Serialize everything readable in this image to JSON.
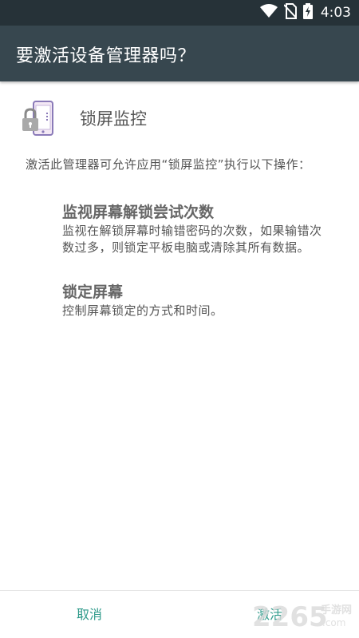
{
  "status_bar": {
    "time": "4:03",
    "icons": [
      "wifi-icon",
      "no-sim-icon",
      "battery-charging-icon"
    ]
  },
  "dialog": {
    "title": "要激活设备管理器吗？",
    "app_name": "锁屏监控",
    "description": "激活此管理器可允许应用“锁屏监控”执行以下操作：",
    "policies": [
      {
        "title": "监视屏幕解锁尝试次数",
        "description": "监视在解锁屏幕时输错密码的次数，如果输错次数过多，则锁定平板电脑或清除其所有数据。"
      },
      {
        "title": "锁定屏幕",
        "description": "控制屏幕锁定的方式和时间。"
      }
    ],
    "cancel_label": "取消",
    "activate_label": "激活"
  },
  "watermark": {
    "brand": "2265",
    "text": "手游网",
    "domain": ".com"
  },
  "colors": {
    "status_bar": "#263238",
    "app_bar": "#37474f",
    "accent": "#2e9a8a"
  }
}
